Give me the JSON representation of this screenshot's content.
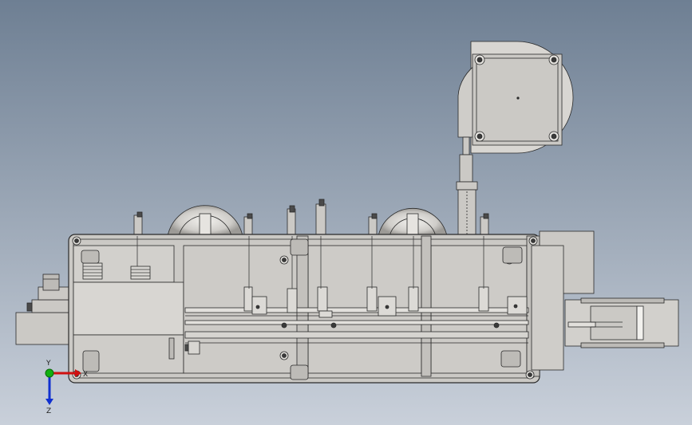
{
  "viewport": {
    "background_top": "#6e7f93",
    "background_bottom": "#c9d0da"
  },
  "triad": {
    "x_label": "X",
    "y_label": "Y",
    "z_label": "Z",
    "x_color": "#d01010",
    "y_color": "#10b010",
    "z_color": "#1030d0"
  },
  "palette": {
    "body": "#cbc9c5",
    "body_light": "#dcdad6",
    "outline": "#2a2a2a",
    "dark": "#4a4a4a",
    "shade": "#a9a7a3"
  }
}
